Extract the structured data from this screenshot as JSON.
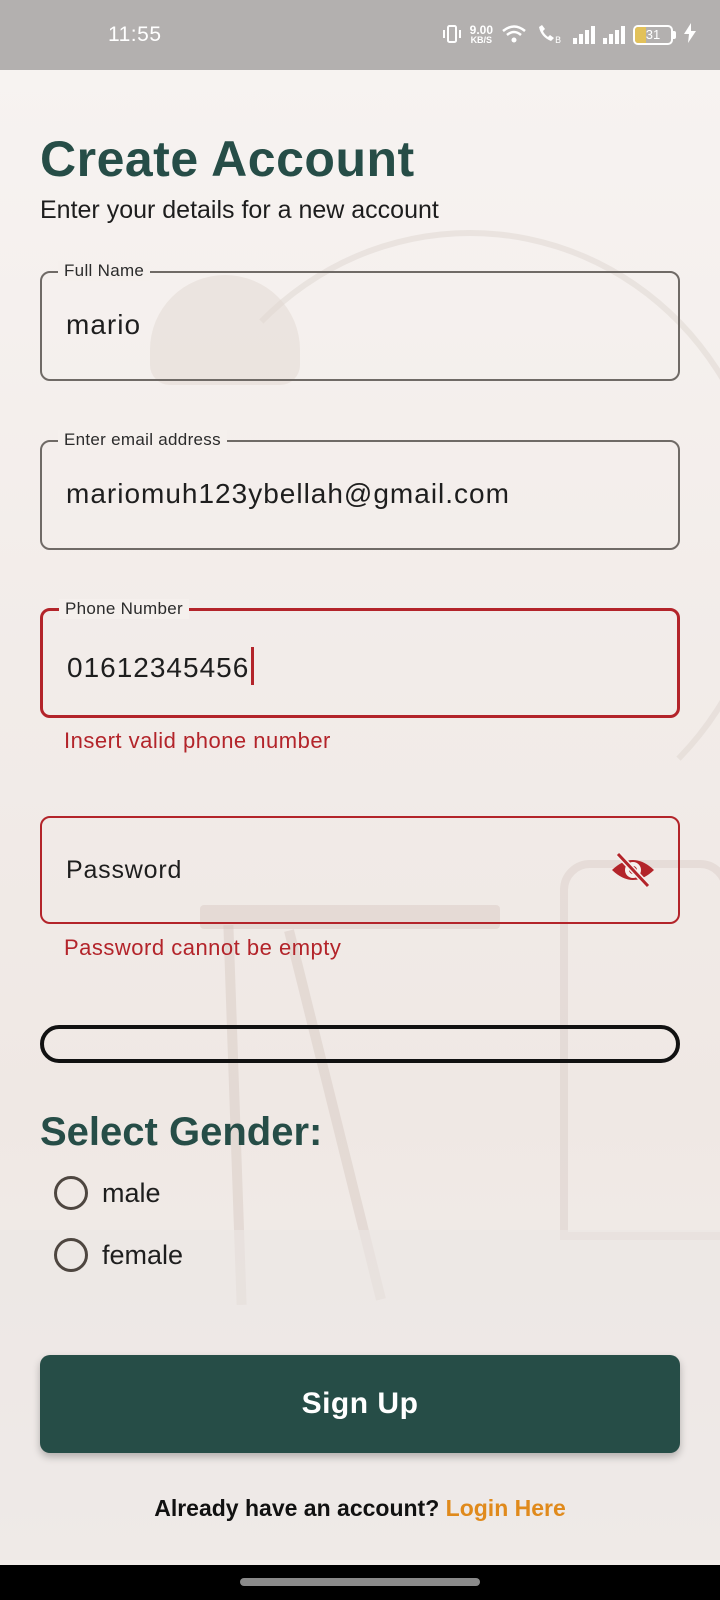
{
  "status_bar": {
    "time": "11:55",
    "net_speed_value": "9.00",
    "net_speed_unit": "KB/S",
    "battery_level": "31",
    "battery_fraction": 0.31
  },
  "page": {
    "title": "Create Account",
    "subtitle": "Enter your details for a new account"
  },
  "form": {
    "full_name": {
      "label": "Full Name",
      "value": "mario"
    },
    "email": {
      "label": "Enter email address",
      "value": "mariomuh123ybellah@gmail.com"
    },
    "phone": {
      "label": "Phone Number",
      "value": "01612345456",
      "error": "Insert valid phone number"
    },
    "password": {
      "placeholder": "Password",
      "error": "Password cannot be empty"
    },
    "password_strength": 0
  },
  "gender": {
    "title": "Select Gender:",
    "options": [
      "male",
      "female"
    ]
  },
  "actions": {
    "signup_label": "Sign Up",
    "login_prompt": "Already have an account?",
    "login_link": "Login Here"
  },
  "colors": {
    "primary": "#264d47",
    "error": "#b3242a",
    "link": "#e08a1c"
  }
}
